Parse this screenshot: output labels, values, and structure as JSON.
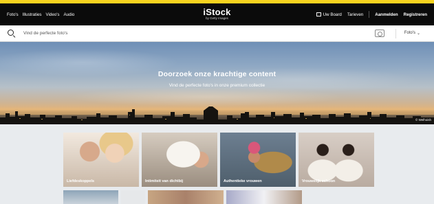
{
  "topnav": {
    "items": [
      "Foto's",
      "Illustraties",
      "Video's",
      "Audio"
    ]
  },
  "logo": {
    "name": "iStock",
    "tagline": "by Getty Images"
  },
  "account": {
    "board_label": "Uw Board",
    "pricing_label": "Tarieven",
    "login_label": "Aanmelden",
    "register_label": "Registreren"
  },
  "search": {
    "placeholder": "Vind de perfecte foto's",
    "filter_label": "Foto's",
    "chevron": "⌄"
  },
  "hero": {
    "title": "Doorzoek onze krachtige content",
    "subtitle": "Vind de perfecte foto's in onze premium collectie",
    "credit": "© Welhoish"
  },
  "categories": [
    {
      "label": "Liefdeskoppels"
    },
    {
      "label": "Intimiteit van dichtbij"
    },
    {
      "label": "Authentieke vrouwen"
    },
    {
      "label": "Vrouwelijk schoon"
    }
  ],
  "colors": {
    "accent_yellow": "#f8d31f",
    "topbar": "#0b0b0b"
  }
}
